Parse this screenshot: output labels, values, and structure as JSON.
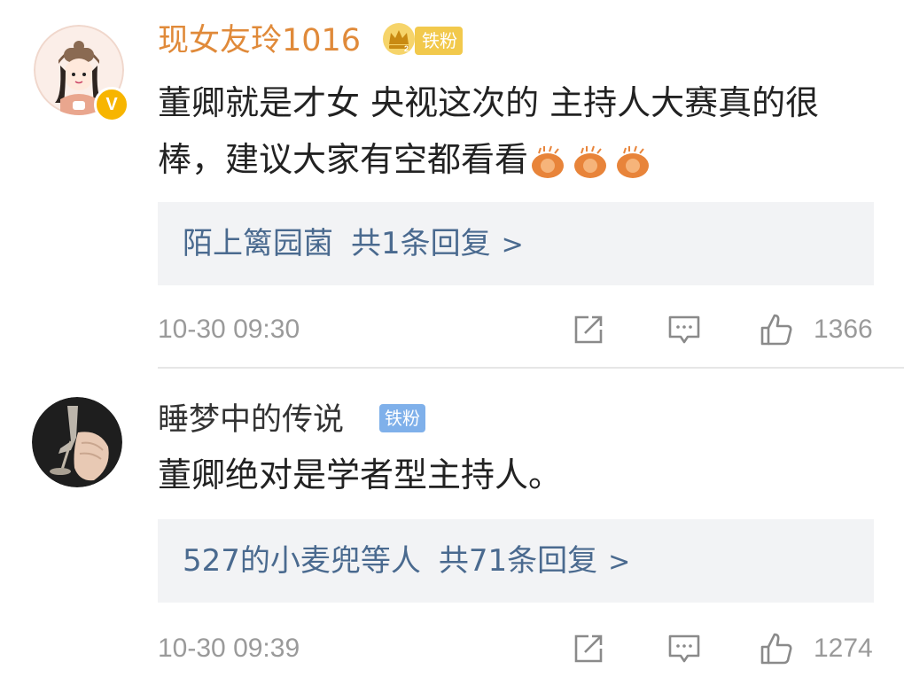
{
  "comments": [
    {
      "username": "现女友玲1016",
      "badge": "铁粉",
      "text": "董卿就是才女  央视这次的 主持人大赛真的很棒，建议大家有空都看看",
      "replies_summary": {
        "names": "陌上篱园菌",
        "count_text": "共1条回复",
        "chevron": ">"
      },
      "time": "10-30 09:30",
      "likes": "1366",
      "verified_badge": "V",
      "badge_color": "#f2c94c",
      "username_color": "#e08a3a"
    },
    {
      "username": "睡梦中的传说",
      "badge": "铁粉",
      "text": "董卿绝对是学者型主持人。",
      "replies_summary": {
        "names": "527的小麦兜等人",
        "count_text": "共71条回复",
        "chevron": ">"
      },
      "time": "10-30 09:39",
      "likes": "1274",
      "badge_color": "#7fb0ea",
      "username_color": "#333333"
    }
  ],
  "icons": {
    "share": "share-icon",
    "reply": "comment-icon",
    "like": "thumbs-up-icon",
    "emoji": "clap-hands-emoji-icon",
    "crown": "crown-icon"
  }
}
